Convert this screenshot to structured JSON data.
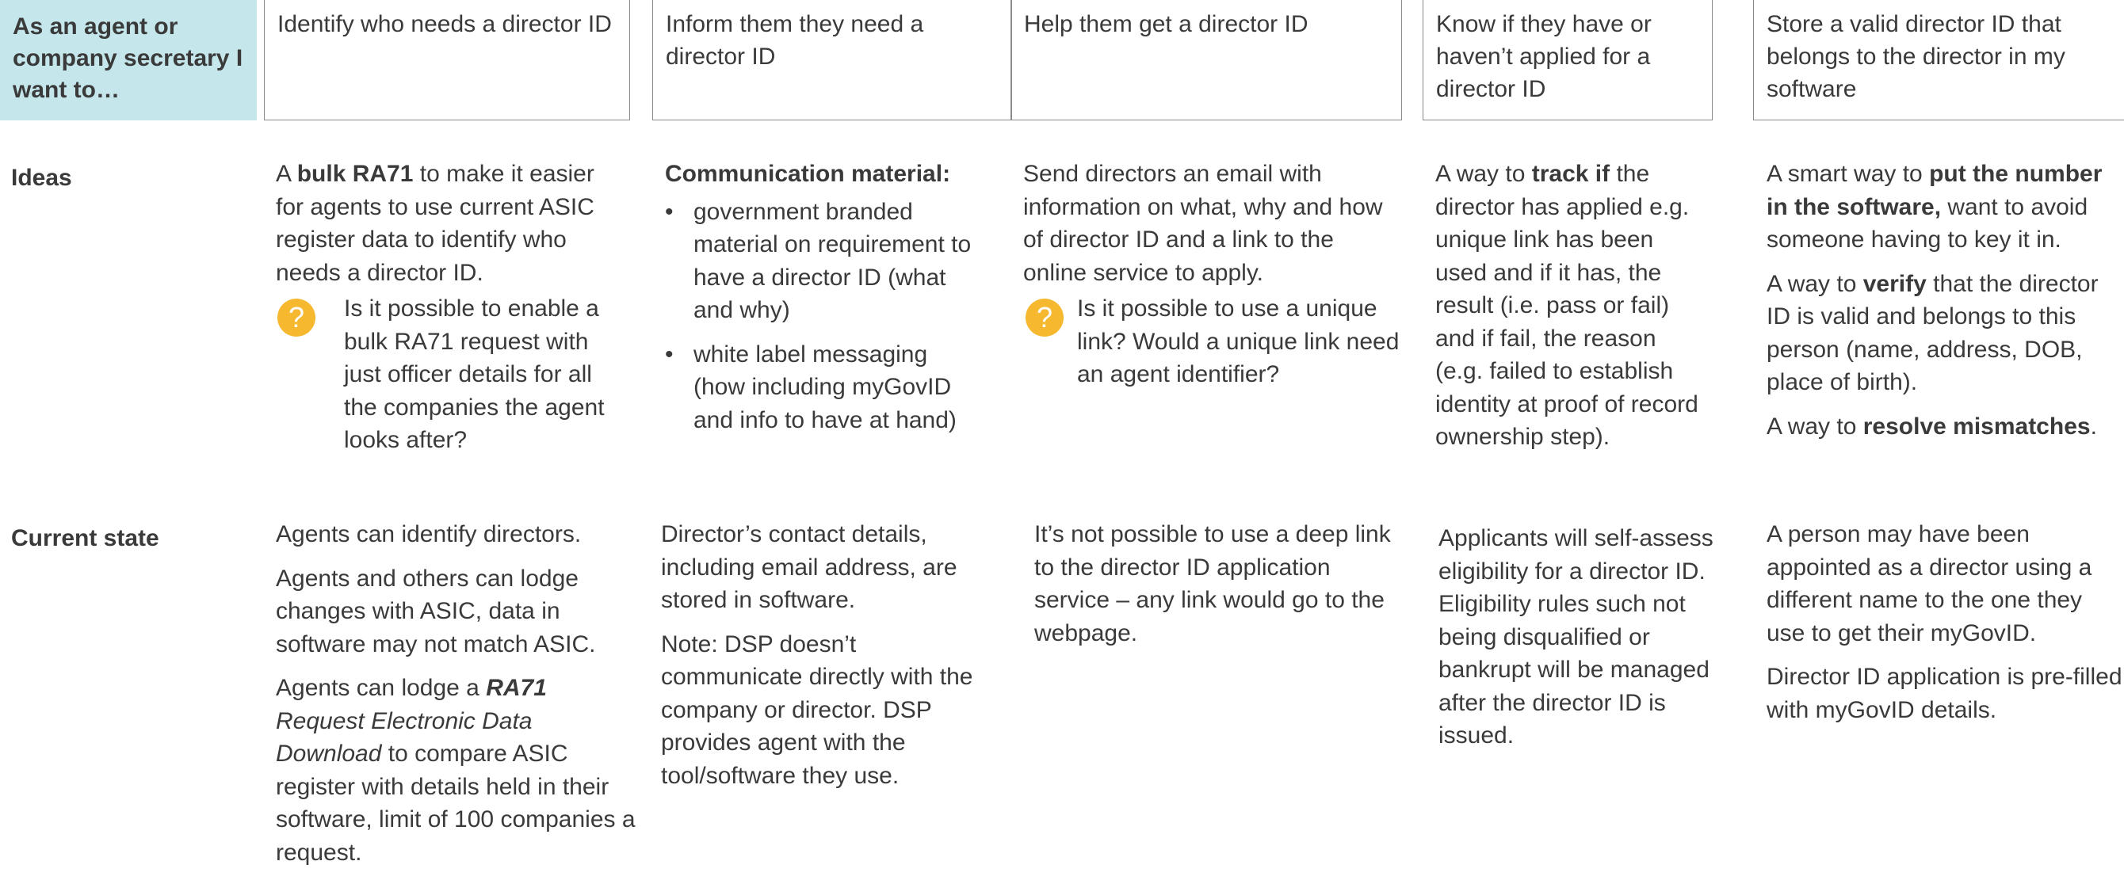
{
  "header": {
    "label": "As an agent or company secretary I want to…",
    "columns": [
      "Identify who needs a director ID",
      "Inform them they need a director ID",
      "Help them get a director ID",
      "Know if they have or haven’t applied for a director ID",
      "Store a valid director ID that belongs to the director in my software"
    ]
  },
  "rows": {
    "ideas_label": "Ideas",
    "current_state_label": "Current state"
  },
  "icons": {
    "question": "question-mark-icon",
    "question_color": "#f5b82e"
  },
  "ideas": {
    "col1": {
      "t1": "A ",
      "b1": "bulk RA71",
      "t2": " to make it easier for agents to use current ASIC register data to identify who needs a director ID.",
      "question": "Is it possible to enable a bulk RA71 request with just officer details for all the companies the agent looks after?"
    },
    "col2": {
      "heading": "Communication material:",
      "bullet_symbol": "•",
      "bullets": [
        "government branded material on requirement to have a director ID (what and why)",
        "white label messaging (how including myGovID and info to have at hand)"
      ]
    },
    "col3": {
      "text": "Send directors an email with information on what, why and how of director ID and a link to the online service to apply.",
      "question": "Is it possible to use a unique link? Would a unique link need an agent identifier?"
    },
    "col4": {
      "t1": "A way to ",
      "b1": "track if",
      "t2": " the director has applied e.g. unique link has been used and if it has, the result (i.e. pass or fail) and if fail, the reason (e.g. failed to establish identity at proof of record ownership step)."
    },
    "col5": {
      "p1_t1": "A smart way to ",
      "p1_b1": "put the number in the software,",
      "p1_t2": " want to avoid someone having to key it in.",
      "p2_t1": "A way to ",
      "p2_b1": "verify",
      "p2_t2": " that the director ID is valid and belongs to this person (name, address, DOB, place of birth).",
      "p3_t1": "A way to ",
      "p3_b1": "resolve mismatches",
      "p3_t2": "."
    }
  },
  "current_state": {
    "col1": {
      "p1": "Agents can identify directors.",
      "p2": "Agents and others can lodge changes with ASIC, data in software may not match ASIC.",
      "p3_t1": "Agents can lodge a ",
      "p3_bi": "RA71",
      "p3_i": " Request Electronic Data Download",
      "p3_t2": " to compare ASIC register with details held in their software, limit of 100 companies a request."
    },
    "col2": {
      "p1": "Director’s contact details, including email address, are stored in software.",
      "p2": "Note: DSP doesn’t communicate directly with the company or director. DSP provides agent with the tool/software they use."
    },
    "col3": {
      "p1": "It’s not possible to use a deep link to the director ID application service – any link would go to the webpage."
    },
    "col4": {
      "p1": "Applicants will self-assess eligibility for a director ID. Eligibility rules such not being disqualified or bankrupt will be managed after the director ID is issued."
    },
    "col5": {
      "p1": "A person may have been appointed as a director using a different name to the one they use to get their myGovID.",
      "p2": "Director ID application is pre-filled with myGovID details."
    }
  }
}
